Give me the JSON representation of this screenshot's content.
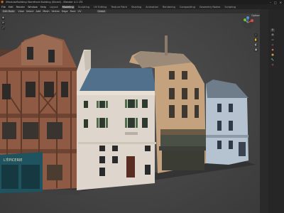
{
  "window": {
    "title": "\\ModularBuilding Storefront Building (Sliced) - Blender 4.2 LTS"
  },
  "menus": [
    "File",
    "Edit",
    "Render",
    "Window",
    "Help"
  ],
  "workspaces": [
    "Layout",
    "Modeling",
    "Sculpting",
    "UV Editing",
    "Texture Paint",
    "Shading",
    "Animation",
    "Rendering",
    "Compositing",
    "Geometry Nodes",
    "Scripting"
  ],
  "active_workspace": "Modeling",
  "header": {
    "mode": "Edit Mode",
    "items": [
      "View",
      "Select",
      "Add",
      "Mesh",
      "Vertex",
      "Edge",
      "Face",
      "UV"
    ],
    "orientation": "Global",
    "options_label": "Options"
  },
  "viewport": {
    "shop_sign": "L'ÉPICERIE",
    "gizmo_axes": [
      "X",
      "Y",
      "Z"
    ],
    "colors": {
      "timber_building": "#8f5a44",
      "white_house": "#ded6cc",
      "blue_roof": "#50708c",
      "tan_building": "#c3a27d",
      "pale_blue_house": "#b5c2cf",
      "storefront_teal": "#1f5360"
    }
  },
  "icons": [
    "blender-logo-icon",
    "minimize-icon",
    "maximize-icon",
    "close-icon",
    "move-tool-icon",
    "rotate-tool-icon",
    "scale-tool-icon",
    "zoom-icon",
    "hand-icon",
    "camera-icon",
    "grid-icon"
  ]
}
